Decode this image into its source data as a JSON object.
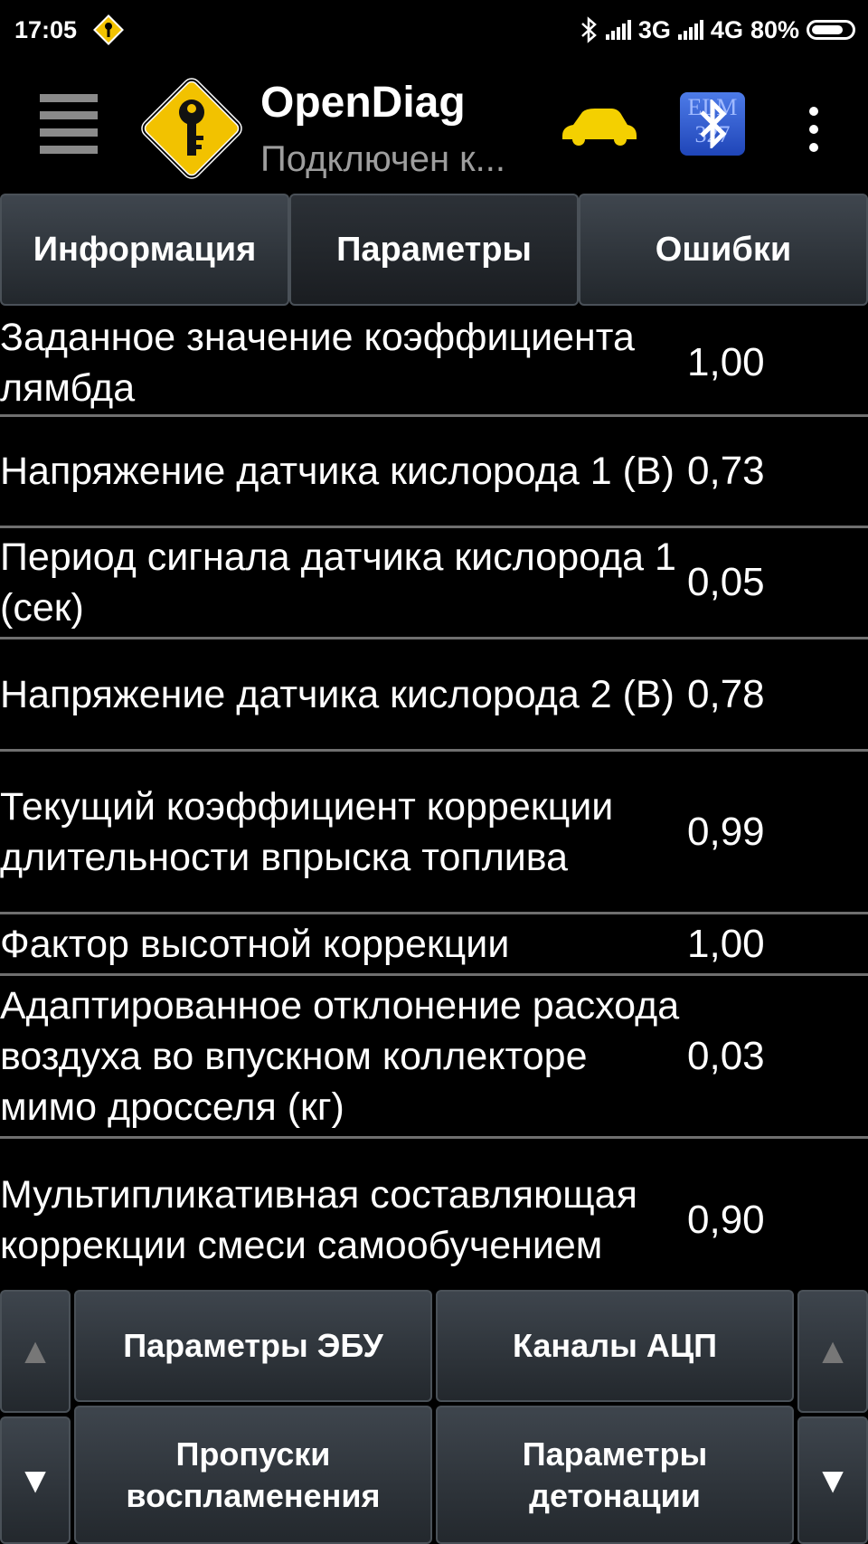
{
  "status_bar": {
    "time": "17:05",
    "network_3g": "3G",
    "network_4g": "4G",
    "battery": "80%"
  },
  "app_bar": {
    "title": "OpenDiag",
    "subtitle": "Подключен к...",
    "bt_badge_top": "ELM",
    "bt_badge_bottom": "327"
  },
  "tabs": [
    {
      "label": "Информация"
    },
    {
      "label": "Параметры"
    },
    {
      "label": "Ошибки"
    }
  ],
  "params": [
    {
      "name": "Заданное значение коэффициента лямбда",
      "value": "1,00"
    },
    {
      "name": "Напряжение датчика кислорода 1 (В)",
      "value": "0,73"
    },
    {
      "name": "Период сигнала датчика кислорода 1 (сек)",
      "value": "0,05"
    },
    {
      "name": "Напряжение датчика кислорода 2 (В)",
      "value": "0,78"
    },
    {
      "name": "Текущий коэффициент коррекции длительности впрыска топлива",
      "value": "0,99"
    },
    {
      "name": "Фактор высотной коррекции",
      "value": "1,00"
    },
    {
      "name": "Адаптированное отклонение расхода воздуха во впускном коллекторе мимо дросселя (кг)",
      "value": "0,03"
    },
    {
      "name": "Мультипликативная составляющая коррекции смеси самообучением",
      "value": "0,90"
    }
  ],
  "bottom_nav": {
    "up_left": "▲",
    "down_left": "▼",
    "up_right": "▲",
    "down_right": "▼",
    "ecu_params": "Параметры ЭБУ",
    "adc_channels": "Каналы АЦП",
    "misfires": "Пропуски воспламенения",
    "knock_params": "Параметры детонации"
  },
  "colors": {
    "background": "#000000",
    "logo_yellow": "#f2c200",
    "car_yellow": "#f4d000",
    "bt_blue": "#2f5fd6"
  }
}
